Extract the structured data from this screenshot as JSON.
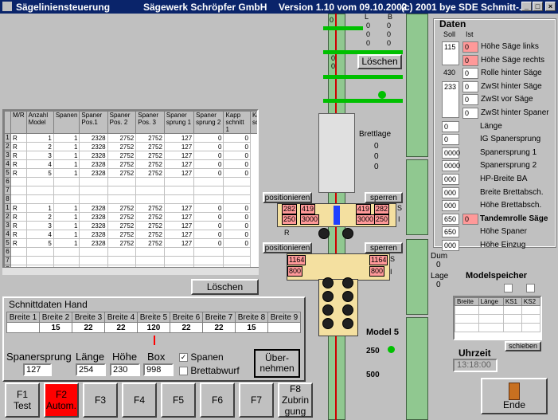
{
  "window": {
    "title_app": "Sägelinien­steuerung",
    "title_company": "Sägewerk Schröpfer GmbH",
    "title_version": "Version 1.10 vom 09.10.2002",
    "title_copy": "(c) 2001 bye SDE Schmitt-...",
    "min": "_",
    "max": "□",
    "close": "×"
  },
  "table": {
    "headers": [
      "M/R",
      "Anzahl Model",
      "Spanen",
      "Spaner Pos.1",
      "Spaner Pos. 2",
      "Spaner Pos. 3",
      "Spaner sprung 1",
      "Spaner sprung 2",
      "Kapp schnitt 1",
      "Kapp schnit"
    ],
    "rows": [
      [
        "1",
        "R",
        "1",
        "1",
        "2328",
        "2752",
        "2752",
        "127",
        "0",
        "0"
      ],
      [
        "2",
        "R",
        "2",
        "1",
        "2328",
        "2752",
        "2752",
        "127",
        "0",
        "0"
      ],
      [
        "3",
        "R",
        "3",
        "1",
        "2328",
        "2752",
        "2752",
        "127",
        "0",
        "0"
      ],
      [
        "4",
        "R",
        "4",
        "1",
        "2328",
        "2752",
        "2752",
        "127",
        "0",
        "0"
      ],
      [
        "5",
        "R",
        "5",
        "1",
        "2328",
        "2752",
        "2752",
        "127",
        "0",
        "0"
      ],
      [
        "6",
        "",
        "",
        "",
        "",
        "",
        "",
        "",
        "",
        ""
      ],
      [
        "7",
        "",
        "",
        "",
        "",
        "",
        "",
        "",
        "",
        ""
      ],
      [
        "8",
        "",
        "",
        "",
        "",
        "",
        "",
        "",
        "",
        ""
      ],
      [
        "1",
        "R",
        "1",
        "1",
        "2328",
        "2752",
        "2752",
        "127",
        "0",
        "0"
      ],
      [
        "2",
        "R",
        "2",
        "1",
        "2328",
        "2752",
        "2752",
        "127",
        "0",
        "0"
      ],
      [
        "3",
        "R",
        "3",
        "1",
        "2328",
        "2752",
        "2752",
        "127",
        "0",
        "0"
      ],
      [
        "4",
        "R",
        "4",
        "1",
        "2328",
        "2752",
        "2752",
        "127",
        "0",
        "0"
      ],
      [
        "5",
        "R",
        "5",
        "1",
        "2328",
        "2752",
        "2752",
        "127",
        "0",
        "0"
      ],
      [
        "6",
        "",
        "",
        "",
        "",
        "",
        "",
        "",
        "",
        ""
      ],
      [
        "7",
        "",
        "",
        "",
        "",
        "",
        "",
        "",
        "",
        ""
      ],
      [
        "8",
        "",
        "",
        "",
        "",
        "",
        "",
        "",
        "",
        ""
      ]
    ]
  },
  "buttons": {
    "loeschen_top": "Löschen",
    "loeschen_table": "Löschen",
    "positionieren1": "positionieren",
    "sperren1": "sperren",
    "positionieren2": "positionieren",
    "sperren2": "sperren",
    "uebernehmen": "Über-nehmen",
    "schieben": "schieben",
    "ende": "Ende"
  },
  "hand": {
    "title": "Schnittdaten Hand",
    "breiten": [
      "Breite 1",
      "Breite 2",
      "Breite 3",
      "Breite 4",
      "Breite 5",
      "Breite 6",
      "Breite 7",
      "Breite 8",
      "Breite 9"
    ],
    "werte": [
      "",
      "15",
      "22",
      "22",
      "120",
      "22",
      "22",
      "15",
      ""
    ],
    "spanersprung_label": "Spanersprung",
    "spanersprung": "127",
    "laenge_label": "Länge",
    "laenge": "254",
    "hoehe_label": "Höhe",
    "hoehe": "230",
    "box_label": "Box",
    "box": "998",
    "spanen_label": "Spanen",
    "spanen_check": "✓",
    "brettabwurf_label": "Brettabwurf"
  },
  "fkeys": [
    {
      "line1": "F1",
      "line2": "Test"
    },
    {
      "line1": "F2",
      "line2": "Autom."
    },
    {
      "line1": "F3",
      "line2": ""
    },
    {
      "line1": "F4",
      "line2": ""
    },
    {
      "line1": "F5",
      "line2": ""
    },
    {
      "line1": "F6",
      "line2": ""
    },
    {
      "line1": "F7",
      "line2": ""
    },
    {
      "line1": "F8",
      "line2": "Zubrin gung"
    }
  ],
  "daten": {
    "title": "Daten",
    "soll": "Soll",
    "ist": "Ist",
    "rows": [
      {
        "soll": "115",
        "ist": "0",
        "label": "Höhe Säge links"
      },
      {
        "soll": "",
        "ist": "0",
        "label": "Höhe Säge rechts"
      },
      {
        "soll": "430",
        "ist": "0",
        "label": "Rolle hinter Säge"
      },
      {
        "soll": "233",
        "ist": "0",
        "label": "ZwSt hinter Säge"
      },
      {
        "soll": "",
        "ist": "0",
        "label": "ZwSt vor Säge"
      },
      {
        "soll": "",
        "ist": "0",
        "label": "ZwSt hinter Spaner"
      },
      {
        "soll": "0",
        "ist": "",
        "label": "Länge"
      },
      {
        "soll": "0",
        "ist": "",
        "label": "IG Spanersprung"
      },
      {
        "soll": "0000",
        "ist": "",
        "label": "Spanersprung 1"
      },
      {
        "soll": "0000",
        "ist": "",
        "label": "Spanersprung 2"
      },
      {
        "soll": "000",
        "ist": "",
        "label": "HP-Breite BA"
      },
      {
        "soll": "000",
        "ist": "",
        "label": "Breite Brettabsch."
      },
      {
        "soll": "000",
        "ist": "",
        "label": "Höhe Brettabsch."
      },
      {
        "soll": "650",
        "ist": "0",
        "label": "Tandemrolle Säge"
      },
      {
        "soll": "650",
        "ist": "",
        "label": "Höhe Spaner"
      },
      {
        "soll": "000",
        "ist": "",
        "label": "Höhe Einzug"
      }
    ]
  },
  "machine": {
    "brettlage": "Brettlage",
    "brettlage_vals": [
      "0",
      "0",
      "0"
    ],
    "top_zeros": [
      "0",
      "0",
      "0",
      "0",
      "0",
      "0",
      "0",
      "0",
      "0"
    ],
    "L": "L",
    "B": "B",
    "m1": [
      "282",
      "419",
      "419",
      "282"
    ],
    "m2": [
      "250",
      "3000",
      "3000",
      "250"
    ],
    "m3": [
      "1164",
      "1164"
    ],
    "m4": [
      "800",
      "800"
    ],
    "S": "S",
    "I": "I",
    "R": "R",
    "model": "Model 5",
    "v250": "250",
    "v500": "500"
  },
  "dum_label": "Dum",
  "dum": "0",
  "lage_label": "Lage",
  "lage": "0",
  "modelspeicher": {
    "title": "Modelspeicher",
    "cols": [
      "Breite",
      "Länge",
      "KS1",
      "KS2"
    ]
  },
  "uhrzeit": {
    "label": "Uhrzeit",
    "value": "13:18:00"
  },
  "colors": {
    "title_bg": "#0a246a",
    "face": "#c0c0c0",
    "red": "#ff0000",
    "pink": "#ff9999",
    "green": "#00c000"
  }
}
